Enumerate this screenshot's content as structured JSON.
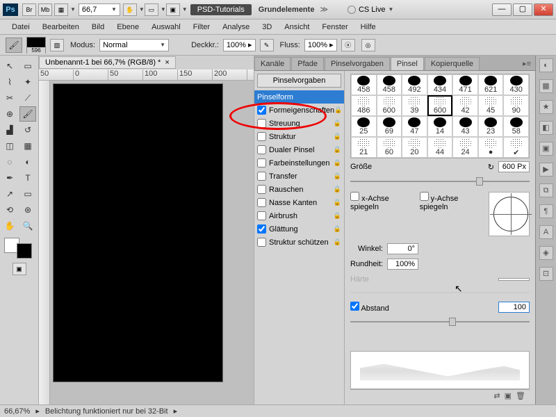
{
  "titlebar": {
    "zoom": "66,7",
    "pill": "PSD-Tutorials",
    "subtitle": "Grundelemente",
    "chev": "≫",
    "cslive": "CS Live"
  },
  "menu": [
    "Datei",
    "Bearbeiten",
    "Bild",
    "Ebene",
    "Auswahl",
    "Filter",
    "Analyse",
    "3D",
    "Ansicht",
    "Fenster",
    "Hilfe"
  ],
  "optbar": {
    "modus_label": "Modus:",
    "modus_value": "Normal",
    "deckkr_label": "Deckkr.:",
    "deckkr_value": "100%",
    "fluss_label": "Fluss:",
    "fluss_value": "100%"
  },
  "doc": {
    "tab": "Unbenannt-1 bei 66,7% (RGB/8) *"
  },
  "ruler_marks_h": [
    "50",
    "0",
    "50",
    "100",
    "150",
    "200"
  ],
  "panel": {
    "tabs": [
      "Kanäle",
      "Pfade",
      "Pinselvorgaben",
      "Pinsel",
      "Kopierquelle"
    ],
    "active_tab": 3,
    "headbtn": "Pinselvorgaben",
    "options": [
      {
        "label": "Pinselform",
        "checked": false,
        "selected": true
      },
      {
        "label": "Formeigenschaften",
        "checked": true,
        "lock": true
      },
      {
        "label": "Streuung",
        "checked": false,
        "lock": true
      },
      {
        "label": "Struktur",
        "checked": false,
        "lock": true
      },
      {
        "label": "Dualer Pinsel",
        "checked": false,
        "lock": true
      },
      {
        "label": "Farbeinstellungen",
        "checked": false,
        "lock": true
      },
      {
        "label": "Transfer",
        "checked": false,
        "lock": true
      },
      {
        "label": "Rauschen",
        "checked": false,
        "lock": true
      },
      {
        "label": "Nasse Kanten",
        "checked": false,
        "lock": true
      },
      {
        "label": "Airbrush",
        "checked": false,
        "lock": true
      },
      {
        "label": "Glättung",
        "checked": true,
        "lock": true
      },
      {
        "label": "Struktur schützen",
        "checked": false,
        "lock": true
      }
    ],
    "thumbs_row1": [
      "458",
      "458",
      "492",
      "434",
      "471",
      "621",
      "430"
    ],
    "thumbs_row2": [
      "486",
      "600",
      "39",
      "600",
      "42",
      "45",
      "90"
    ],
    "thumbs_row3": [
      "25",
      "69",
      "47",
      "14",
      "43",
      "23",
      "58"
    ],
    "thumbs_row4": [
      "21",
      "60",
      "20",
      "44",
      "24",
      "●",
      "✔"
    ],
    "selected_thumb_idx": 10,
    "size_label": "Größe",
    "size_value": "600 Px",
    "flipx": "x-Achse spiegeln",
    "flipy": "y-Achse spiegeln",
    "winkel_label": "Winkel:",
    "winkel_value": "0°",
    "rundheit_label": "Rundheit:",
    "rundheit_value": "100%",
    "haerte_label": "Härte",
    "abstand_label": "Abstand",
    "abstand_value": "100"
  },
  "status": {
    "zoom": "66,67%",
    "msg": "Belichtung funktioniert nur bei 32-Bit"
  }
}
